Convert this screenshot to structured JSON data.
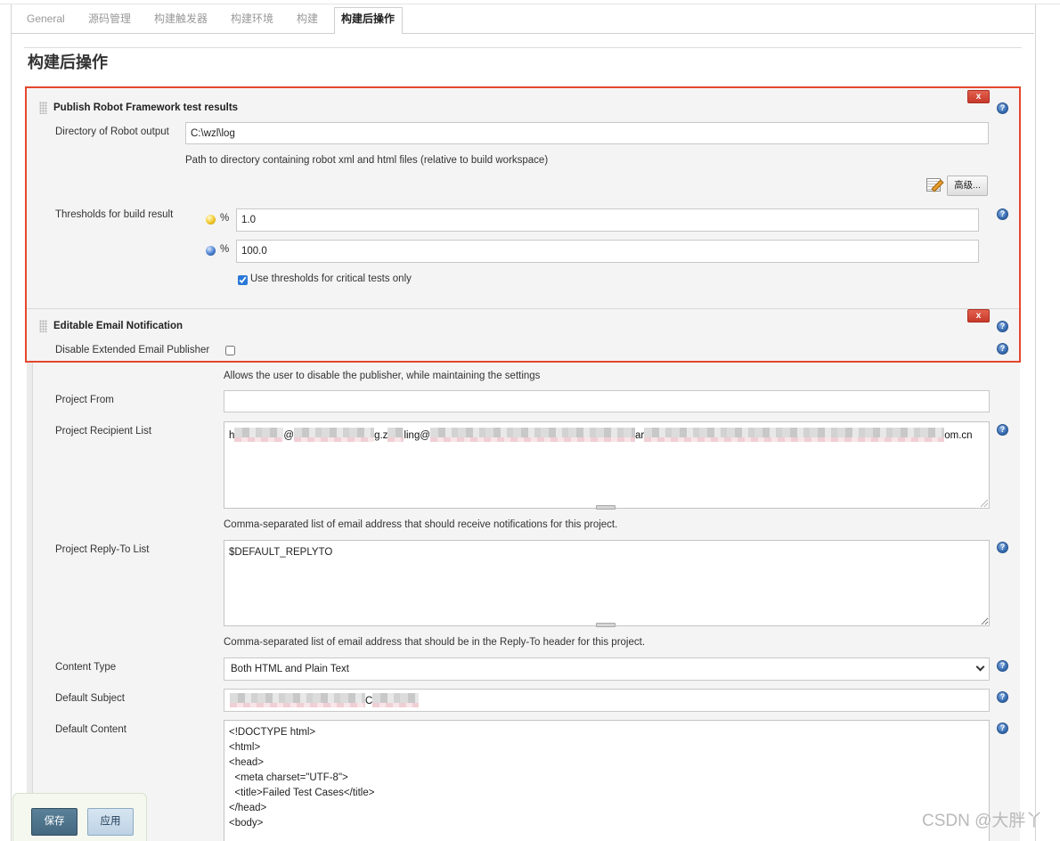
{
  "tabs": [
    {
      "label": "General"
    },
    {
      "label": "源码管理"
    },
    {
      "label": "构建触发器"
    },
    {
      "label": "构建环境"
    },
    {
      "label": "构建"
    },
    {
      "label": "构建后操作",
      "active": true
    }
  ],
  "page_title": "构建后操作",
  "help_icon_glyph": "?",
  "robot_section": {
    "title": "Publish Robot Framework test results",
    "delete_label": "x",
    "output_dir": {
      "label": "Directory of Robot output",
      "value": "C:\\wzl\\log",
      "help_text": "Path to directory containing robot xml and html files (relative to build workspace)"
    },
    "advanced_button": "高级...",
    "thresholds": {
      "label": "Thresholds for build result",
      "unstable": {
        "unit": "%",
        "value": "1.0"
      },
      "pass": {
        "unit": "%",
        "value": "100.0"
      }
    },
    "critical_only": {
      "label": "Use thresholds for critical tests only",
      "checked": true
    }
  },
  "email_section": {
    "title": "Editable Email Notification",
    "delete_label": "x",
    "disable_publisher": {
      "label": "Disable Extended Email Publisher",
      "checked": false,
      "help_text": "Allows the user to disable the publisher, while maintaining the settings"
    },
    "project_from": {
      "label": "Project From",
      "value": ""
    },
    "recipient_list": {
      "label": "Project Recipient List",
      "visible_fragments": [
        "h",
        "@",
        "g.z",
        "ling@",
        "ar",
        "om.cn"
      ],
      "help_text": "Comma-separated list of email address that should receive notifications for this project."
    },
    "reply_to": {
      "label": "Project Reply-To List",
      "value": "$DEFAULT_REPLYTO",
      "help_text": "Comma-separated list of email address that should be in the Reply-To header for this project."
    },
    "content_type": {
      "label": "Content Type",
      "selected": "Both HTML and Plain Text"
    },
    "default_subject": {
      "label": "Default Subject",
      "visible_fragments": [
        "C"
      ]
    },
    "default_content": {
      "label": "Default Content",
      "value": "<!DOCTYPE html>\n<html>\n<head>\n  <meta charset=\"UTF-8\">\n  <title>Failed Test Cases</title>\n</head>\n<body>"
    }
  },
  "footer": {
    "save_label": "保存",
    "apply_label": "应用"
  },
  "watermark": "CSDN @大胖丫",
  "icons": {
    "drag_handle": "drag-handle-icon",
    "help": "help-icon",
    "unstable_threshold": "yellow-ball-icon",
    "failure_threshold": "blue-ball-icon",
    "edited_indicator": "edit-notepad-icon",
    "select_arrow": "chevron-down-icon"
  },
  "colors": {
    "highlight_red": "#e4472d",
    "delete_red": "#c7392a",
    "help_blue": "#2e63a8",
    "save_blue": "#4a6f86",
    "apply_blue": "#c9dcec"
  }
}
